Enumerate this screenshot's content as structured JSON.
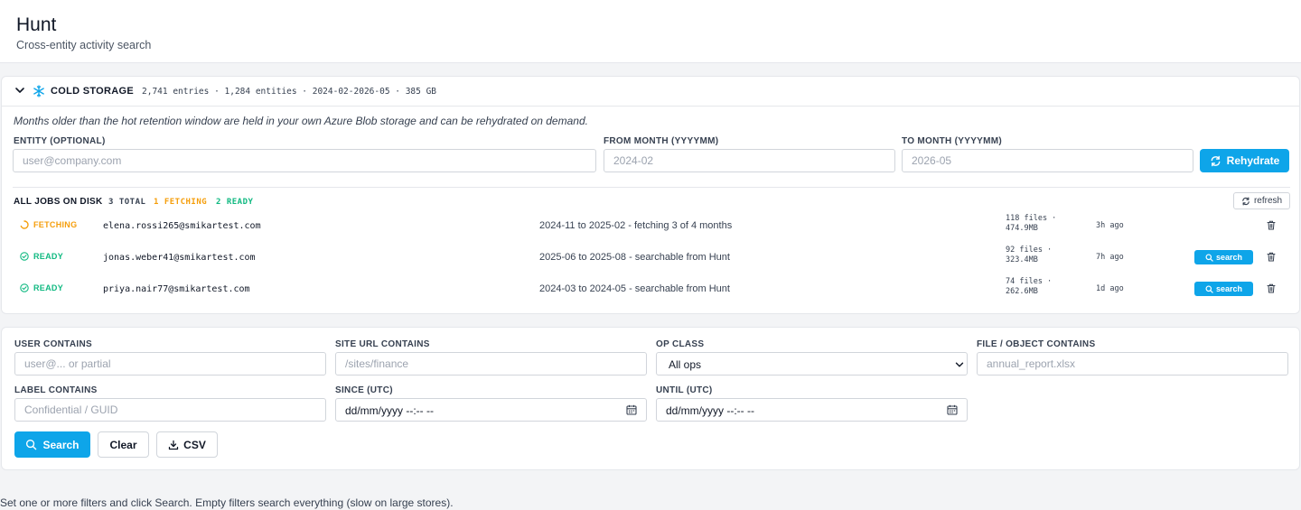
{
  "header": {
    "title": "Hunt",
    "subtitle": "Cross-entity activity search"
  },
  "cold_storage": {
    "title": "COLD STORAGE",
    "stats": "2,741 entries · 1,284 entities · 2024-02-2026-05 · 385 GB",
    "description": "Months older than the hot retention window are held in your own Azure Blob storage and can be rehydrated on demand.",
    "entity_label": "ENTITY (OPTIONAL)",
    "entity_placeholder": "user@company.com",
    "from_label": "FROM MONTH (YYYYMM)",
    "from_placeholder": "2024-02",
    "to_label": "TO MONTH (YYYYMM)",
    "to_placeholder": "2026-05",
    "rehydrate_label": "Rehydrate"
  },
  "jobs": {
    "title": "ALL JOBS ON DISK",
    "total": "3 TOTAL",
    "fetching": "1 FETCHING",
    "ready": "2 READY",
    "refresh_label": "refresh",
    "search_label": "search",
    "rows": [
      {
        "status": "FETCHING",
        "entity": "elena.rossi265@smikartest.com",
        "range": "2024-11 to 2025-02 - fetching 3 of 4 months",
        "files_line1": "118 files ·",
        "files_line2": "474.9MB",
        "age": "3h ago"
      },
      {
        "status": "READY",
        "entity": "jonas.weber41@smikartest.com",
        "range": "2025-06 to 2025-08 - searchable from Hunt",
        "files_line1": "92 files ·",
        "files_line2": "323.4MB",
        "age": "7h ago"
      },
      {
        "status": "READY",
        "entity": "priya.nair77@smikartest.com",
        "range": "2024-03 to 2024-05 - searchable from Hunt",
        "files_line1": "74 files ·",
        "files_line2": "262.6MB",
        "age": "1d ago"
      }
    ]
  },
  "filters": {
    "user_label": "USER CONTAINS",
    "user_placeholder": "user@... or partial",
    "site_label": "SITE URL CONTAINS",
    "site_placeholder": "/sites/finance",
    "op_label": "OP CLASS",
    "op_value": "All ops",
    "file_label": "FILE / OBJECT CONTAINS",
    "file_placeholder": "annual_report.xlsx",
    "label_label": "LABEL CONTAINS",
    "label_placeholder": "Confidential / GUID",
    "since_label": "SINCE (UTC)",
    "since_value": "dd/mm/yyyy --:-- --",
    "until_label": "UNTIL (UTC)",
    "until_value": "dd/mm/yyyy --:-- --",
    "search_label": "Search",
    "clear_label": "Clear",
    "csv_label": "CSV"
  },
  "hint": "Set one or more filters and click Search. Empty filters search everything (slow on large stores).",
  "colors": {
    "accent": "#0ea5e9",
    "fetching": "#f59e0b",
    "ready": "#10b981"
  }
}
